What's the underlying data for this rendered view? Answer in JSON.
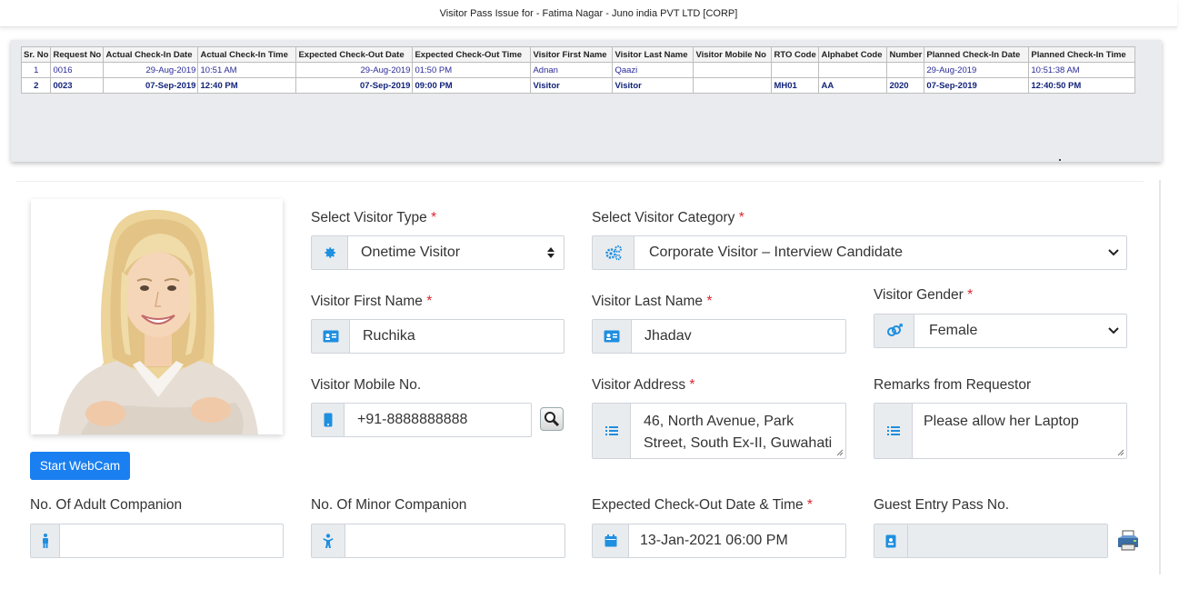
{
  "header": {
    "title": "Visitor Pass Issue for - Fatima Nagar - Juno india PVT LTD [CORP]"
  },
  "table": {
    "columns": [
      "Sr. No",
      "Request No",
      "Actual Check-In Date",
      "Actual Check-In Time",
      "Expected Check-Out Date",
      "Expected Check-Out Time",
      "Visitor First Name",
      "Visitor Last Name",
      "Visitor Mobile No",
      "RTO Code",
      "Alphabet Code",
      "Number",
      "Planned Check-In Date",
      "Planned Check-In Time"
    ],
    "rows": [
      [
        "1",
        "0016",
        "29-Aug-2019",
        "10:51 AM",
        "29-Aug-2019",
        "01:50 PM",
        "Adnan",
        "Qaazi",
        "",
        "",
        "",
        "",
        "29-Aug-2019",
        "10:51:38 AM"
      ],
      [
        "2",
        "0023",
        "07-Sep-2019",
        "12:40 PM",
        "07-Sep-2019",
        "09:00 PM",
        "Visitor",
        "Visitor",
        "",
        "MH01",
        "AA",
        "2020",
        "07-Sep-2019",
        "12:40:50 PM"
      ]
    ]
  },
  "photo": {
    "webcam_button": "Start WebCam"
  },
  "form": {
    "visitor_type": {
      "label": "Select Visitor Type",
      "required": "*",
      "value": "Onetime Visitor",
      "icon": "gear-icon"
    },
    "visitor_category": {
      "label": "Select Visitor Category",
      "required": "*",
      "value": "Corporate Visitor – Interview Candidate",
      "icon": "gears-icon"
    },
    "first_name": {
      "label": "Visitor First Name",
      "required": "*",
      "value": "Ruchika",
      "icon": "id-card-icon"
    },
    "last_name": {
      "label": "Visitor Last Name",
      "required": "*",
      "value": "Jhadav",
      "icon": "id-card-icon"
    },
    "gender": {
      "label": "Visitor Gender",
      "required": "*",
      "value": "Female",
      "icon": "gender-icon"
    },
    "mobile": {
      "label": "Visitor Mobile No.",
      "value": "+91-8888888888",
      "icon": "mobile-icon"
    },
    "address": {
      "label": "Visitor Address",
      "required": "*",
      "value": "46, North Avenue, Park Street, South Ex-II, Guwahati",
      "icon": "list-icon"
    },
    "remarks": {
      "label": "Remarks from Requestor",
      "value": "Please allow her Laptop",
      "icon": "list-icon"
    },
    "adult_companion": {
      "label": "No. Of Adult Companion",
      "value": "",
      "icon": "male-icon"
    },
    "minor_companion": {
      "label": "No. Of Minor Companion",
      "value": "",
      "icon": "child-icon"
    },
    "checkout": {
      "label": "Expected Check-Out Date & Time",
      "required": "*",
      "value": "13-Jan-2021 06:00 PM",
      "icon": "calendar-icon"
    },
    "guest_pass": {
      "label": "Guest Entry Pass No.",
      "value": "",
      "icon": "badge-icon"
    }
  }
}
